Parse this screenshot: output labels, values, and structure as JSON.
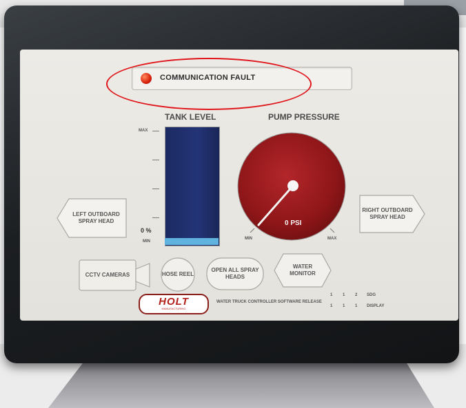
{
  "fault": {
    "label": "COMMUNICATION FAULT",
    "led_color": "#d8200c"
  },
  "tank": {
    "title": "TANK LEVEL",
    "max_label": "MAX",
    "min_label": "MIN",
    "percent_label": "0 %",
    "level_fraction": 0.05,
    "fill_color": "#5fb3de",
    "body_color": "#1f2f6a"
  },
  "pump": {
    "title": "PUMP PRESSURE",
    "value_label": "0 PSI",
    "min_label": "MIN",
    "max_label": "MAX",
    "dial_color": "#8e1618"
  },
  "buttons": {
    "left_spray": "LEFT OUTBOARD SPRAY HEAD",
    "right_spray": "RIGHT OUTBOARD SPRAY HEAD",
    "cctv": "CCTV CAMERAS",
    "hose_reel": "HOSE REEL",
    "open_all": "OPEN ALL SPRAY HEADS",
    "water_monitor": "WATER MONITOR"
  },
  "footer": {
    "logo_text": "HOLT",
    "logo_sub": "MANUFACTURING",
    "software_release_label": "WATER TRUCK CONTROLLER SOFTWARE RELEASE",
    "row1": [
      "1",
      "1",
      "2",
      "SDG"
    ],
    "row2": [
      "1",
      "1",
      "1",
      "DISPLAY"
    ]
  }
}
